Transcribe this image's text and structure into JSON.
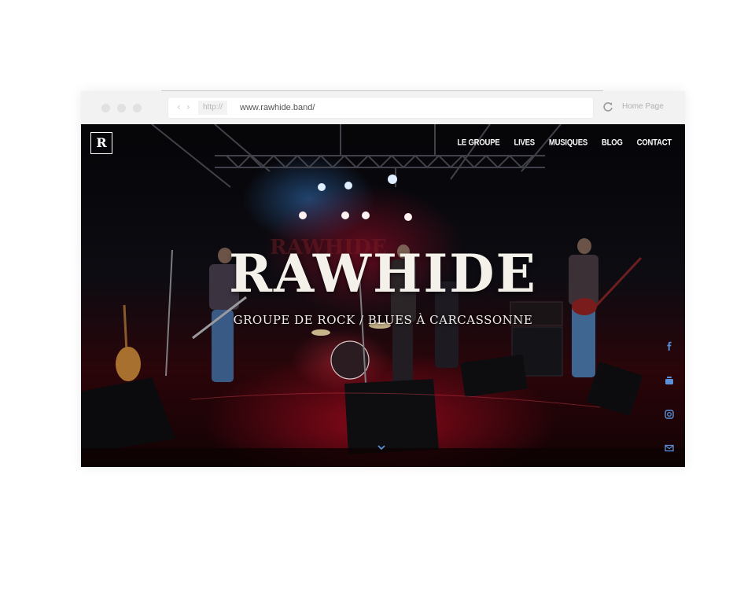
{
  "browser": {
    "protocol": "http://",
    "url": "www.rawhide.band/",
    "home_label": "Home Page",
    "nav_back_icon": "chevron-left-icon",
    "nav_forward_icon": "chevron-right-icon",
    "reload_icon": "reload-icon"
  },
  "site": {
    "logo_letter": "R",
    "nav": [
      "LE GROUPE",
      "LIVES",
      "MUSIQUES",
      "BLOG",
      "CONTACT"
    ],
    "hero_title": "RAWHIDE",
    "hero_subtitle": "GROUPE DE ROCK / BLUES À CARCASSONNE",
    "social_icons": [
      "facebook-icon",
      "youtube-icon",
      "instagram-icon",
      "mail-icon"
    ],
    "scroll_icon": "chevron-down-icon",
    "accent_color": "#5b8fd6"
  }
}
